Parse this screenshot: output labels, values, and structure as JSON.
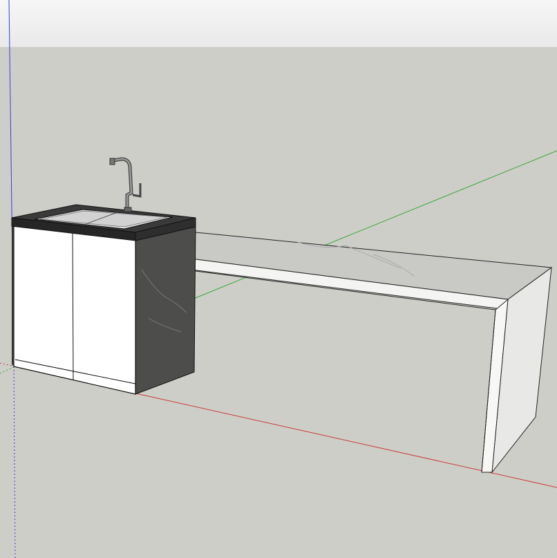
{
  "scene": {
    "sky_color": "#eeeeee",
    "ground_color": "#cecec8",
    "axes": {
      "red": "#c83a3a",
      "green": "#3aa53a",
      "blue": "#3a3ae0"
    },
    "model": {
      "cabinet_color": "#ffffff",
      "countertop_color": "#2b2b2b",
      "stone_side_color": "#4a4a48",
      "table_color": "#f4f4f2",
      "faucet_color": "#7a7a7a",
      "sink_color": "#e8e8e8"
    }
  }
}
